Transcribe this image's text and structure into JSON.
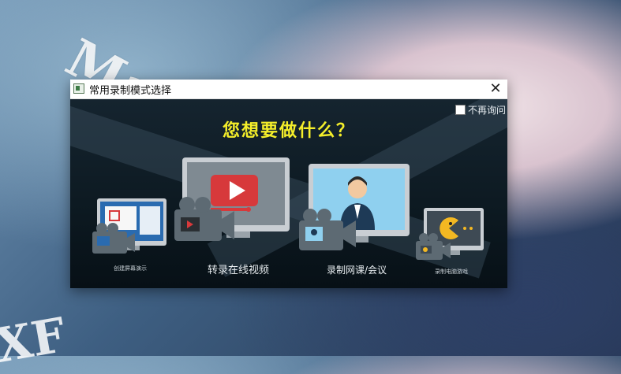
{
  "watermark": {
    "text": "MacXF.com",
    "corner_text": "XF"
  },
  "dialog": {
    "title": "常用录制模式选择",
    "close_glyph": "✕",
    "dont_ask_label": "不再询问",
    "dont_ask_checked": false,
    "headline": "您想要做什么？",
    "options": [
      {
        "label": "创建屏幕演示"
      },
      {
        "label": "转录在线视频"
      },
      {
        "label": "录制网课/会议"
      },
      {
        "label": "录制电脑游戏"
      }
    ]
  },
  "colors": {
    "headline": "#f4ee2a",
    "monitor_frame": "#c9ced3",
    "camera_body": "#5d6a73",
    "play_red": "#d7393b",
    "game_yellow": "#f3b822"
  }
}
